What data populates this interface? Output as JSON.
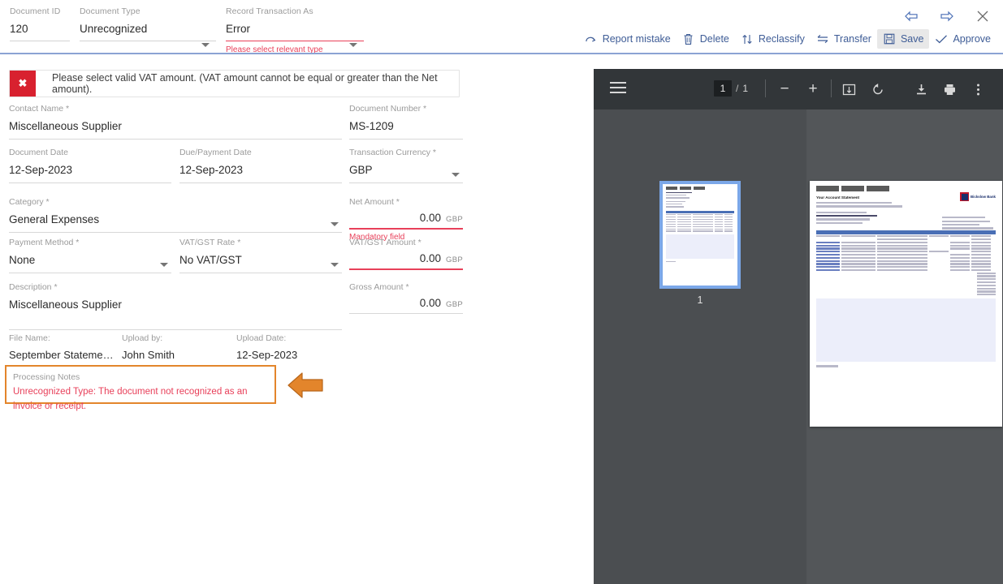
{
  "header": {
    "fields": [
      {
        "label": "Document ID",
        "value": "120",
        "type": "text",
        "error": ""
      },
      {
        "label": "Document Type",
        "value": "Unrecognized",
        "type": "select",
        "error": ""
      },
      {
        "label": "Record Transaction As",
        "value": "Error",
        "type": "select",
        "error": "Please select relevant type"
      }
    ],
    "nav": [
      {
        "name": "back-arrow-icon",
        "glyph": "⇦"
      },
      {
        "name": "forward-arrow-icon",
        "glyph": "⇨"
      },
      {
        "name": "close-icon",
        "glyph": "✕"
      }
    ],
    "toolbar": [
      {
        "label": "Report mistake",
        "icon": "report-mistake-icon",
        "active": false
      },
      {
        "label": "Delete",
        "icon": "trash-icon",
        "active": false
      },
      {
        "label": "Reclassify",
        "icon": "reclassify-icon",
        "active": false
      },
      {
        "label": "Transfer",
        "icon": "transfer-icon",
        "active": false
      },
      {
        "label": "Save",
        "icon": "save-icon",
        "active": true
      },
      {
        "label": "Approve",
        "icon": "check-icon",
        "active": false
      }
    ],
    "accent_color": "#3e5c96",
    "divider_color": "#8ba3d4"
  },
  "banner": {
    "icon": "✖",
    "message": "Please select valid VAT amount. (VAT amount cannot be equal or greater than the Net amount).",
    "icon_bg": "#d8212f"
  },
  "form": {
    "contact_name": {
      "label": "Contact Name *",
      "value": "Miscellaneous Supplier"
    },
    "document_number": {
      "label": "Document Number *",
      "value": "MS-1209"
    },
    "document_date": {
      "label": "Document Date",
      "value": "12-Sep-2023"
    },
    "due_payment_date": {
      "label": "Due/Payment Date",
      "value": "12-Sep-2023"
    },
    "transaction_currency": {
      "label": "Transaction Currency *",
      "value": "GBP"
    },
    "category": {
      "label": "Category *",
      "value": "General Expenses"
    },
    "net_amount": {
      "label": "Net Amount *",
      "value": "0.00",
      "currency": "GBP",
      "error": "Mandatory field"
    },
    "payment_method": {
      "label": "Payment Method *",
      "value": "None"
    },
    "vat_gst_rate": {
      "label": "VAT/GST Rate *",
      "value": "No VAT/GST"
    },
    "vat_gst_amount": {
      "label": "VAT/GST Amount *",
      "value": "0.00",
      "currency": "GBP"
    },
    "description": {
      "label": "Description *",
      "value": "Miscellaneous Supplier"
    },
    "gross_amount": {
      "label": "Gross Amount *",
      "value": "0.00",
      "currency": "GBP"
    }
  },
  "meta": {
    "file_name": {
      "label": "File Name:",
      "value": "September Stateme…"
    },
    "upload_by": {
      "label": "Upload by:",
      "value": "John Smith"
    },
    "upload_date": {
      "label": "Upload Date:",
      "value": "12-Sep-2023"
    }
  },
  "processing_notes": {
    "label": "Processing Notes",
    "value": "Unrecognized Type: The document not recognized as an invoice or receipt.",
    "highlight_color": "#e3852b",
    "text_color": "#e8405a"
  },
  "viewer": {
    "menu_icon": "hamburger-menu-icon",
    "current_page": "1",
    "separator": "/",
    "total_pages": "1",
    "zoom_out": "−",
    "zoom_in": "+",
    "fit_icon": "fit-to-page-icon",
    "rotate_icon": "rotate-icon",
    "download_icon": "download-icon",
    "print_icon": "print-icon",
    "more_icon": "more-options-icon",
    "thumbnail_label": "1",
    "background": "#535659",
    "toolbar_background": "#323639"
  },
  "document_preview": {
    "title": "Your Account Statement",
    "bank_name": "Bickslow Bank",
    "section_header": "Account Activity",
    "columns": [
      "Date",
      "Payment Type",
      "Detail",
      "Paid In",
      "Paid Out",
      "Balance"
    ]
  }
}
